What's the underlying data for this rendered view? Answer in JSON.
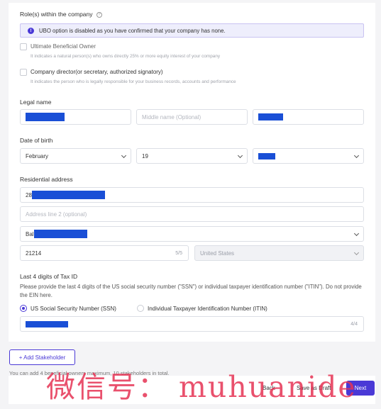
{
  "roles": {
    "heading": "Role(s) within the company",
    "info_text": "UBO option is disabled as you have confirmed that your company has none.",
    "options": [
      {
        "label": "Ultimate Beneficial Owner",
        "hint": "It indicates a natural person(s) who owns directly 25% or more equity interest of your company"
      },
      {
        "label": "Company director(or secretary, authorized signatory)",
        "hint": "It indicates the person who is legally responsible for your business records, accounts and performance"
      }
    ]
  },
  "legal_name": {
    "label": "Legal name",
    "middle_placeholder": "Middle name (Optional)"
  },
  "dob": {
    "label": "Date of birth",
    "month": "February",
    "day": "19"
  },
  "address": {
    "label": "Residential address",
    "line1_prefix": "28",
    "line2_placeholder": "Address line 2 (optional)",
    "city_prefix": "Bal",
    "zip": "21214",
    "zip_counter": "5/5",
    "country": "United States"
  },
  "tax": {
    "label": "Last 4 digits of Tax ID",
    "description": "Please provide the last 4 digits of the US social security number (\"SSN\") or individual taxpayer identification number (\"ITIN\"). Do not provide the EIN here.",
    "option_ssn": "US Social Security Number (SSN)",
    "option_itin": "Individual Taxpayer Identification Number (ITIN)",
    "selected": "ssn",
    "counter": "4/4"
  },
  "footer": {
    "add_stakeholder": "+ Add Stakeholder",
    "note": "You can add 4 beneficial owners maximum, 10 stakeholders in total.",
    "back": "Back",
    "save_draft": "Save as Draft",
    "next": "Next"
  },
  "watermark": "微信号： muhuanide",
  "colors": {
    "accent": "#4a39d6",
    "redaction": "#1a4fd6",
    "info_bg": "#eeeefc",
    "watermark": "#e53353"
  }
}
